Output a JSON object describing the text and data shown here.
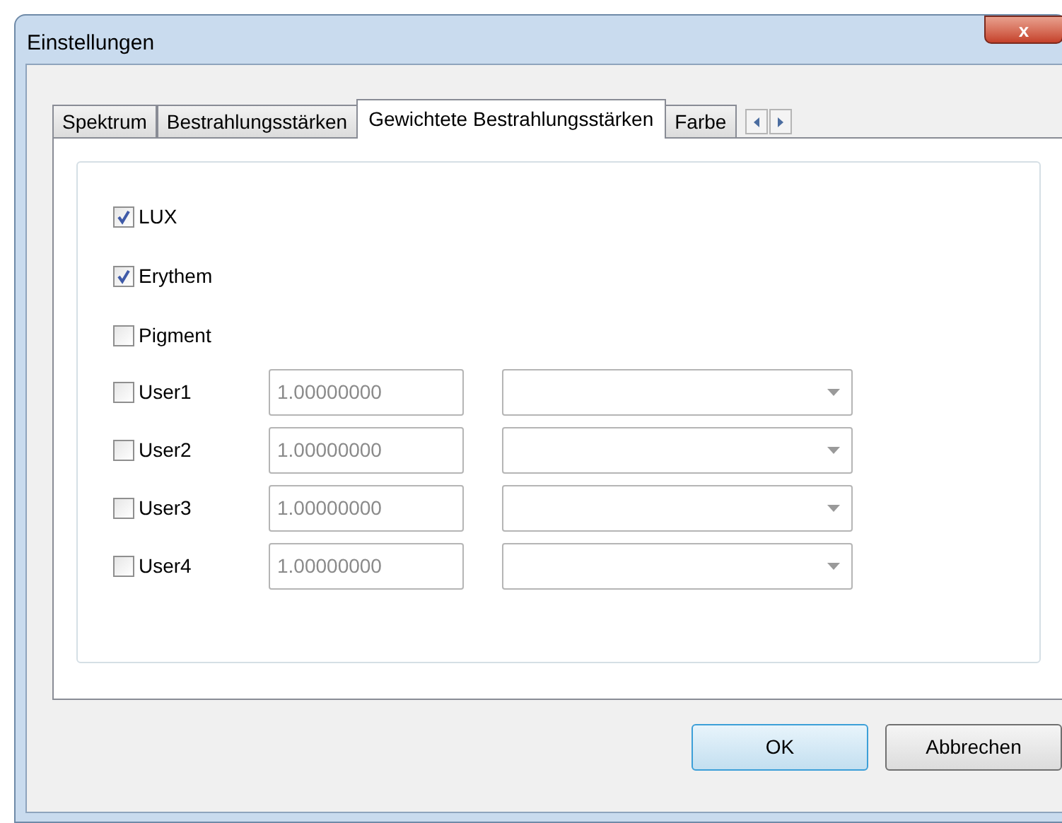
{
  "window": {
    "title": "Einstellungen",
    "close": "x"
  },
  "tabs": [
    {
      "label": "Spektrum",
      "selected": false
    },
    {
      "label": "Bestrahlungsstärken",
      "selected": false
    },
    {
      "label": "Gewichtete Bestrahlungsstärken",
      "selected": true
    },
    {
      "label": "Farbe",
      "selected": false
    }
  ],
  "options": [
    {
      "kind": "checkbox",
      "label": "LUX",
      "checked": true
    },
    {
      "kind": "checkbox",
      "label": "Erythem",
      "checked": true
    },
    {
      "kind": "checkbox",
      "label": "Pigment",
      "checked": false
    },
    {
      "kind": "user",
      "label": "User1",
      "checked": false,
      "factor": "1.00000000",
      "disabled": true
    },
    {
      "kind": "user",
      "label": "User2",
      "checked": false,
      "factor": "1.00000000",
      "disabled": true
    },
    {
      "kind": "user",
      "label": "User3",
      "checked": false,
      "factor": "1.00000000",
      "disabled": true
    },
    {
      "kind": "user",
      "label": "User4",
      "checked": false,
      "factor": "1.00000000",
      "disabled": true
    }
  ],
  "buttons": [
    {
      "label": "OK",
      "kind": "default"
    },
    {
      "label": "Abbrechen",
      "kind": "normal"
    }
  ]
}
